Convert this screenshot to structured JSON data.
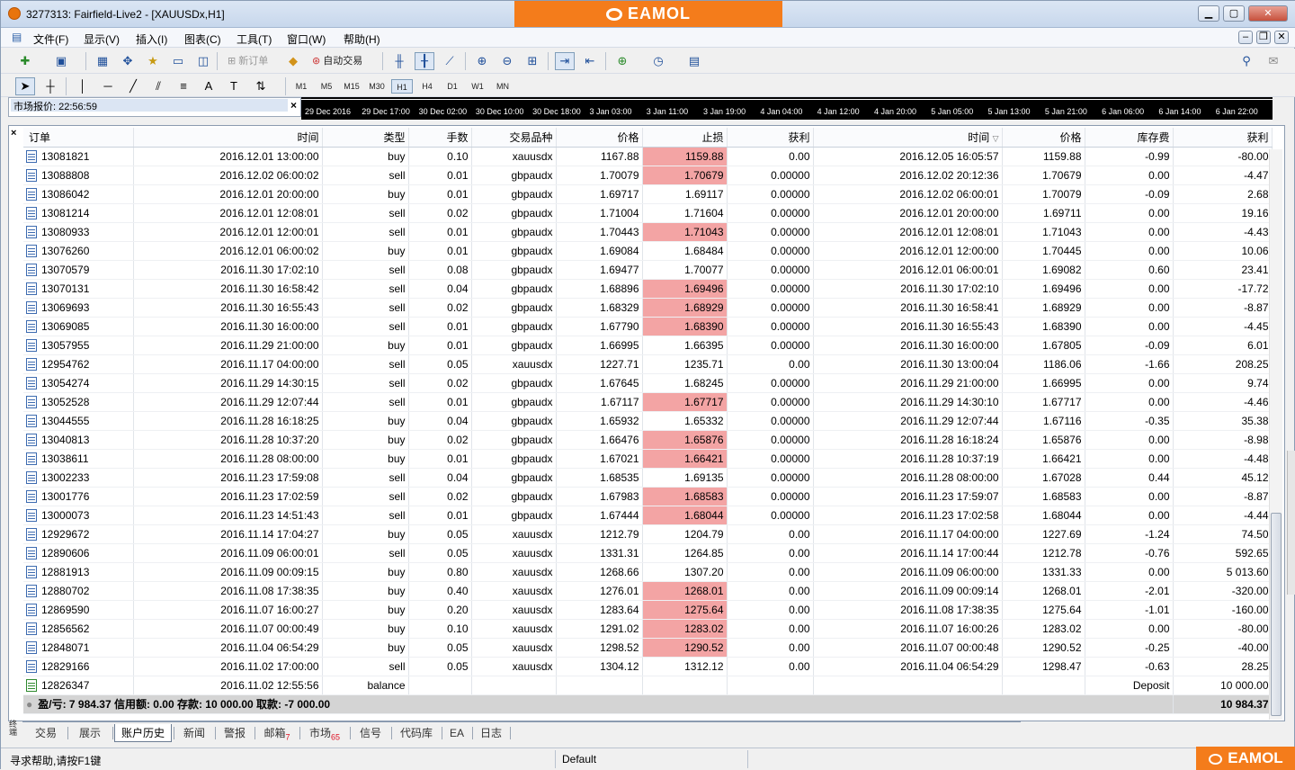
{
  "window": {
    "title": "3277313: Fairfield-Live2 - [XAUUSDx,H1]",
    "brand": "EAMOL"
  },
  "menu": [
    "文件(F)",
    "显示(V)",
    "插入(I)",
    "图表(C)",
    "工具(T)",
    "窗口(W)",
    "帮助(H)"
  ],
  "toolbar": {
    "new_order": "新订单",
    "auto_trade": "自动交易"
  },
  "timeframes": [
    "M1",
    "M5",
    "M15",
    "M30",
    "H1",
    "H4",
    "D1",
    "W1",
    "MN"
  ],
  "active_timeframe": "H1",
  "market_watch": {
    "title": "市场报价: 22:56:59"
  },
  "time_axis": [
    "29 Dec 2016",
    "29 Dec 17:00",
    "30 Dec 02:00",
    "30 Dec 10:00",
    "30 Dec 18:00",
    "3 Jan 03:00",
    "3 Jan 11:00",
    "3 Jan 19:00",
    "4 Jan 04:00",
    "4 Jan 12:00",
    "4 Jan 20:00",
    "5 Jan 05:00",
    "5 Jan 13:00",
    "5 Jan 21:00",
    "6 Jan 06:00",
    "6 Jan 14:00",
    "6 Jan 22:00"
  ],
  "columns": [
    "订单",
    "时间",
    "类型",
    "手数",
    "交易品种",
    "价格",
    "止损",
    "获利",
    "时间",
    "价格",
    "库存费",
    "获利"
  ],
  "rows": [
    [
      "13081821",
      "2016.12.01 13:00:00",
      "buy",
      "0.10",
      "xauusdx",
      "1167.88",
      "1159.88",
      "0.00",
      "2016.12.05 16:05:57",
      "1159.88",
      "-0.99",
      "-80.00",
      true
    ],
    [
      "13088808",
      "2016.12.02 06:00:02",
      "sell",
      "0.01",
      "gbpaudx",
      "1.70079",
      "1.70679",
      "0.00000",
      "2016.12.02 20:12:36",
      "1.70679",
      "0.00",
      "-4.47",
      true
    ],
    [
      "13086042",
      "2016.12.01 20:00:00",
      "buy",
      "0.01",
      "gbpaudx",
      "1.69717",
      "1.69117",
      "0.00000",
      "2016.12.02 06:00:01",
      "1.70079",
      "-0.09",
      "2.68",
      false
    ],
    [
      "13081214",
      "2016.12.01 12:08:01",
      "sell",
      "0.02",
      "gbpaudx",
      "1.71004",
      "1.71604",
      "0.00000",
      "2016.12.01 20:00:00",
      "1.69711",
      "0.00",
      "19.16",
      false
    ],
    [
      "13080933",
      "2016.12.01 12:00:01",
      "sell",
      "0.01",
      "gbpaudx",
      "1.70443",
      "1.71043",
      "0.00000",
      "2016.12.01 12:08:01",
      "1.71043",
      "0.00",
      "-4.43",
      true
    ],
    [
      "13076260",
      "2016.12.01 06:00:02",
      "buy",
      "0.01",
      "gbpaudx",
      "1.69084",
      "1.68484",
      "0.00000",
      "2016.12.01 12:00:00",
      "1.70445",
      "0.00",
      "10.06",
      false
    ],
    [
      "13070579",
      "2016.11.30 17:02:10",
      "sell",
      "0.08",
      "gbpaudx",
      "1.69477",
      "1.70077",
      "0.00000",
      "2016.12.01 06:00:01",
      "1.69082",
      "0.60",
      "23.41",
      false
    ],
    [
      "13070131",
      "2016.11.30 16:58:42",
      "sell",
      "0.04",
      "gbpaudx",
      "1.68896",
      "1.69496",
      "0.00000",
      "2016.11.30 17:02:10",
      "1.69496",
      "0.00",
      "-17.72",
      true
    ],
    [
      "13069693",
      "2016.11.30 16:55:43",
      "sell",
      "0.02",
      "gbpaudx",
      "1.68329",
      "1.68929",
      "0.00000",
      "2016.11.30 16:58:41",
      "1.68929",
      "0.00",
      "-8.87",
      true
    ],
    [
      "13069085",
      "2016.11.30 16:00:00",
      "sell",
      "0.01",
      "gbpaudx",
      "1.67790",
      "1.68390",
      "0.00000",
      "2016.11.30 16:55:43",
      "1.68390",
      "0.00",
      "-4.45",
      true
    ],
    [
      "13057955",
      "2016.11.29 21:00:00",
      "buy",
      "0.01",
      "gbpaudx",
      "1.66995",
      "1.66395",
      "0.00000",
      "2016.11.30 16:00:00",
      "1.67805",
      "-0.09",
      "6.01",
      false
    ],
    [
      "12954762",
      "2016.11.17 04:00:00",
      "sell",
      "0.05",
      "xauusdx",
      "1227.71",
      "1235.71",
      "0.00",
      "2016.11.30 13:00:04",
      "1186.06",
      "-1.66",
      "208.25",
      false
    ],
    [
      "13054274",
      "2016.11.29 14:30:15",
      "sell",
      "0.02",
      "gbpaudx",
      "1.67645",
      "1.68245",
      "0.00000",
      "2016.11.29 21:00:00",
      "1.66995",
      "0.00",
      "9.74",
      false
    ],
    [
      "13052528",
      "2016.11.29 12:07:44",
      "sell",
      "0.01",
      "gbpaudx",
      "1.67117",
      "1.67717",
      "0.00000",
      "2016.11.29 14:30:10",
      "1.67717",
      "0.00",
      "-4.46",
      true
    ],
    [
      "13044555",
      "2016.11.28 16:18:25",
      "buy",
      "0.04",
      "gbpaudx",
      "1.65932",
      "1.65332",
      "0.00000",
      "2016.11.29 12:07:44",
      "1.67116",
      "-0.35",
      "35.38",
      false
    ],
    [
      "13040813",
      "2016.11.28 10:37:20",
      "buy",
      "0.02",
      "gbpaudx",
      "1.66476",
      "1.65876",
      "0.00000",
      "2016.11.28 16:18:24",
      "1.65876",
      "0.00",
      "-8.98",
      true
    ],
    [
      "13038611",
      "2016.11.28 08:00:00",
      "buy",
      "0.01",
      "gbpaudx",
      "1.67021",
      "1.66421",
      "0.00000",
      "2016.11.28 10:37:19",
      "1.66421",
      "0.00",
      "-4.48",
      true
    ],
    [
      "13002233",
      "2016.11.23 17:59:08",
      "sell",
      "0.04",
      "gbpaudx",
      "1.68535",
      "1.69135",
      "0.00000",
      "2016.11.28 08:00:00",
      "1.67028",
      "0.44",
      "45.12",
      false
    ],
    [
      "13001776",
      "2016.11.23 17:02:59",
      "sell",
      "0.02",
      "gbpaudx",
      "1.67983",
      "1.68583",
      "0.00000",
      "2016.11.23 17:59:07",
      "1.68583",
      "0.00",
      "-8.87",
      true
    ],
    [
      "13000073",
      "2016.11.23 14:51:43",
      "sell",
      "0.01",
      "gbpaudx",
      "1.67444",
      "1.68044",
      "0.00000",
      "2016.11.23 17:02:58",
      "1.68044",
      "0.00",
      "-4.44",
      true
    ],
    [
      "12929672",
      "2016.11.14 17:04:27",
      "buy",
      "0.05",
      "xauusdx",
      "1212.79",
      "1204.79",
      "0.00",
      "2016.11.17 04:00:00",
      "1227.69",
      "-1.24",
      "74.50",
      false
    ],
    [
      "12890606",
      "2016.11.09 06:00:01",
      "sell",
      "0.05",
      "xauusdx",
      "1331.31",
      "1264.85",
      "0.00",
      "2016.11.14 17:00:44",
      "1212.78",
      "-0.76",
      "592.65",
      false
    ],
    [
      "12881913",
      "2016.11.09 00:09:15",
      "buy",
      "0.80",
      "xauusdx",
      "1268.66",
      "1307.20",
      "0.00",
      "2016.11.09 06:00:00",
      "1331.33",
      "0.00",
      "5 013.60",
      false
    ],
    [
      "12880702",
      "2016.11.08 17:38:35",
      "buy",
      "0.40",
      "xauusdx",
      "1276.01",
      "1268.01",
      "0.00",
      "2016.11.09 00:09:14",
      "1268.01",
      "-2.01",
      "-320.00",
      true
    ],
    [
      "12869590",
      "2016.11.07 16:00:27",
      "buy",
      "0.20",
      "xauusdx",
      "1283.64",
      "1275.64",
      "0.00",
      "2016.11.08 17:38:35",
      "1275.64",
      "-1.01",
      "-160.00",
      true
    ],
    [
      "12856562",
      "2016.11.07 00:00:49",
      "buy",
      "0.10",
      "xauusdx",
      "1291.02",
      "1283.02",
      "0.00",
      "2016.11.07 16:00:26",
      "1283.02",
      "0.00",
      "-80.00",
      true
    ],
    [
      "12848071",
      "2016.11.04 06:54:29",
      "buy",
      "0.05",
      "xauusdx",
      "1298.52",
      "1290.52",
      "0.00",
      "2016.11.07 00:00:48",
      "1290.52",
      "-0.25",
      "-40.00",
      true
    ],
    [
      "12829166",
      "2016.11.02 17:00:00",
      "sell",
      "0.05",
      "xauusdx",
      "1304.12",
      "1312.12",
      "0.00",
      "2016.11.04 06:54:29",
      "1298.47",
      "-0.63",
      "28.25",
      false
    ]
  ],
  "balance_row": {
    "order": "12826347",
    "time": "2016.11.02 12:55:56",
    "type": "balance",
    "comment": "Deposit",
    "profit": "10 000.00"
  },
  "summary": {
    "text": "盈/亏: 7 984.37  信用额: 0.00  存款: 10 000.00  取款: -7 000.00",
    "total": "10 984.37"
  },
  "tabs": [
    {
      "label": "交易",
      "badge": ""
    },
    {
      "label": "展示",
      "badge": ""
    },
    {
      "label": "账户历史",
      "badge": ""
    },
    {
      "label": "新闻",
      "badge": ""
    },
    {
      "label": "警报",
      "badge": ""
    },
    {
      "label": "邮箱",
      "badge": "7"
    },
    {
      "label": "市场",
      "badge": "65"
    },
    {
      "label": "信号",
      "badge": ""
    },
    {
      "label": "代码库",
      "badge": ""
    },
    {
      "label": "EA",
      "badge": ""
    },
    {
      "label": "日志",
      "badge": ""
    }
  ],
  "active_tab": "账户历史",
  "terminal_label": "终端",
  "status": {
    "help": "寻求帮助,请按F1键",
    "profile": "Default"
  },
  "colors": {
    "stoploss_highlight": "#f3a4a4",
    "brand": "#f47c1b"
  }
}
